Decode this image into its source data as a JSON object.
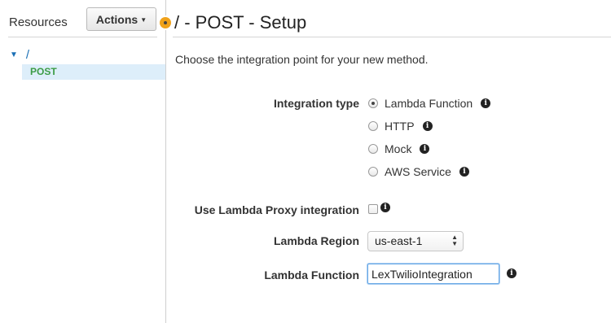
{
  "sidebar": {
    "title": "Resources",
    "actions_label": "Actions",
    "tree": {
      "root": "/",
      "selected_item": "POST"
    }
  },
  "header": {
    "title": "/ - POST - Setup",
    "subtitle": "Choose the integration point for your new method."
  },
  "form": {
    "integration_type": {
      "label": "Integration type",
      "options": [
        "Lambda Function",
        "HTTP",
        "Mock",
        "AWS Service"
      ],
      "selected": "Lambda Function"
    },
    "proxy": {
      "label": "Use Lambda Proxy integration",
      "checked": false
    },
    "region": {
      "label": "Lambda Region",
      "value": "us-east-1"
    },
    "function": {
      "label": "Lambda Function",
      "value": "LexTwilioIntegration"
    }
  },
  "icons": {
    "info": "info-icon",
    "caret": "caret-down-icon",
    "tree_toggle": "triangle-down-icon",
    "status_dot": "orange-dot-icon"
  },
  "colors": {
    "link_blue": "#1a6fb5",
    "method_green": "#3c9c46",
    "selected_bg": "#ddeefa",
    "status_orange": "#f0a21a"
  }
}
